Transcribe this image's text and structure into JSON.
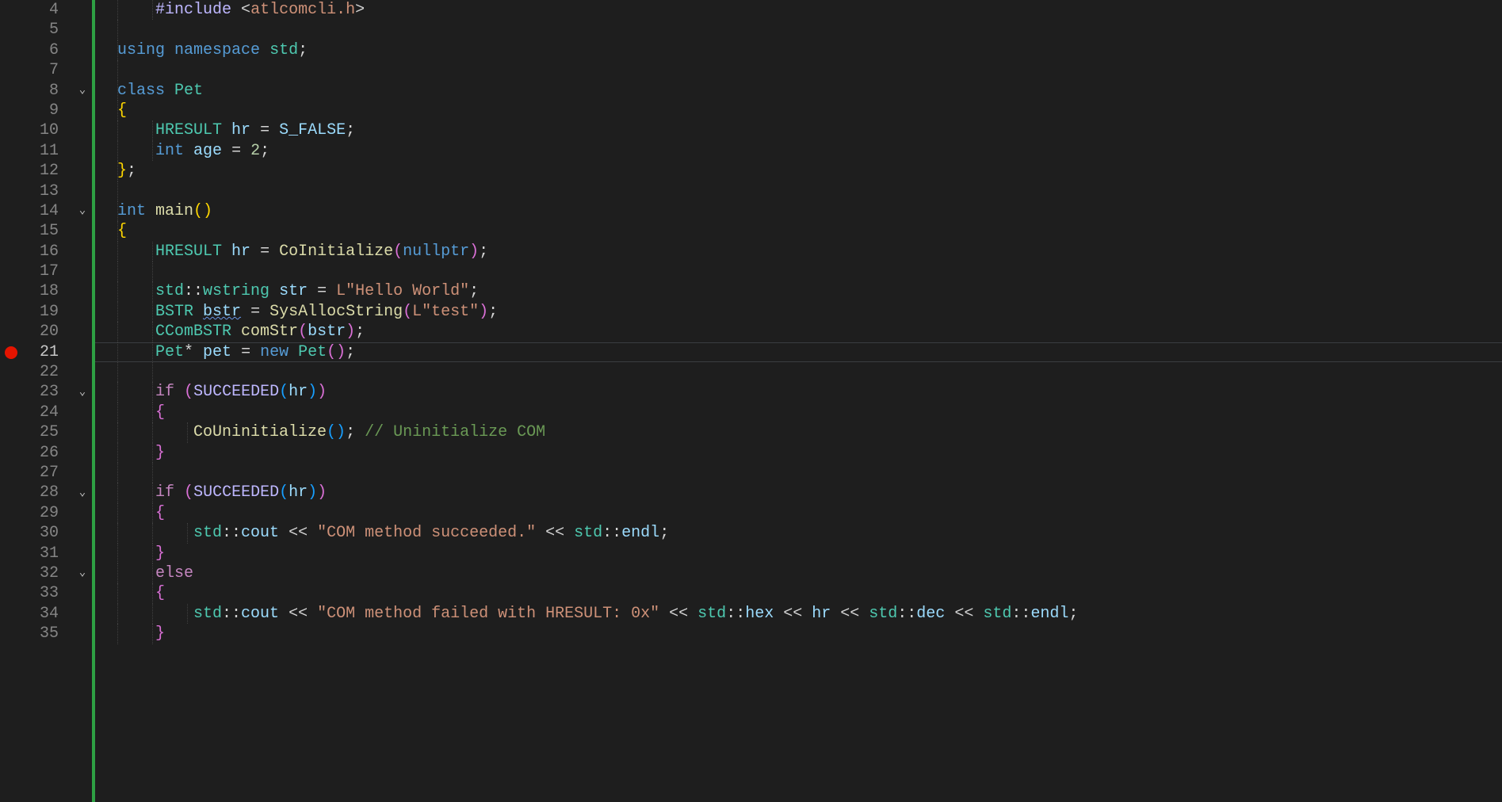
{
  "editor": {
    "first_line_number": 4,
    "last_line_number": 35,
    "current_line": 21,
    "breakpoints": [
      21
    ],
    "fold_markers": {
      "8": "open",
      "14": "open",
      "23": "open",
      "28": "open",
      "32": "open"
    },
    "lines": {
      "4": [
        {
          "cls": "indent",
          "n": 1
        },
        {
          "cls": "tk-macro",
          "t": "#include "
        },
        {
          "cls": "tk-plain",
          "t": "<"
        },
        {
          "cls": "tk-str",
          "t": "atlcomcli.h"
        },
        {
          "cls": "tk-plain",
          "t": ">"
        }
      ],
      "5": [],
      "6": [
        {
          "cls": "tk-kw",
          "t": "using"
        },
        {
          "cls": "tk-plain",
          "t": " "
        },
        {
          "cls": "tk-kw",
          "t": "namespace"
        },
        {
          "cls": "tk-plain",
          "t": " "
        },
        {
          "cls": "tk-type",
          "t": "std"
        },
        {
          "cls": "tk-plain",
          "t": ";"
        }
      ],
      "7": [],
      "8": [
        {
          "cls": "tk-kw",
          "t": "class"
        },
        {
          "cls": "tk-plain",
          "t": " "
        },
        {
          "cls": "tk-type",
          "t": "Pet"
        }
      ],
      "9": [
        {
          "cls": "tk-paren-y",
          "t": "{"
        }
      ],
      "10": [
        {
          "cls": "indent",
          "n": 1
        },
        {
          "cls": "tk-type",
          "t": "HRESULT"
        },
        {
          "cls": "tk-plain",
          "t": " "
        },
        {
          "cls": "tk-var",
          "t": "hr"
        },
        {
          "cls": "tk-plain",
          "t": " = "
        },
        {
          "cls": "tk-var",
          "t": "S_FALSE"
        },
        {
          "cls": "tk-plain",
          "t": ";"
        }
      ],
      "11": [
        {
          "cls": "indent",
          "n": 1
        },
        {
          "cls": "tk-kw",
          "t": "int"
        },
        {
          "cls": "tk-plain",
          "t": " "
        },
        {
          "cls": "tk-var",
          "t": "age"
        },
        {
          "cls": "tk-plain",
          "t": " = "
        },
        {
          "cls": "tk-num",
          "t": "2"
        },
        {
          "cls": "tk-plain",
          "t": ";"
        }
      ],
      "12": [
        {
          "cls": "tk-paren-y",
          "t": "}"
        },
        {
          "cls": "tk-plain",
          "t": ";"
        }
      ],
      "13": [],
      "14": [
        {
          "cls": "tk-kw",
          "t": "int"
        },
        {
          "cls": "tk-plain",
          "t": " "
        },
        {
          "cls": "tk-func",
          "t": "main"
        },
        {
          "cls": "tk-paren-y",
          "t": "()"
        }
      ],
      "15": [
        {
          "cls": "tk-paren-y",
          "t": "{"
        }
      ],
      "16": [
        {
          "cls": "indent",
          "n": 1
        },
        {
          "cls": "tk-type",
          "t": "HRESULT"
        },
        {
          "cls": "tk-plain",
          "t": " "
        },
        {
          "cls": "tk-var",
          "t": "hr"
        },
        {
          "cls": "tk-plain",
          "t": " = "
        },
        {
          "cls": "tk-func",
          "t": "CoInitialize"
        },
        {
          "cls": "tk-paren-p",
          "t": "("
        },
        {
          "cls": "tk-kw",
          "t": "nullptr"
        },
        {
          "cls": "tk-paren-p",
          "t": ")"
        },
        {
          "cls": "tk-plain",
          "t": ";"
        }
      ],
      "17": [
        {
          "cls": "indent",
          "n": 1
        }
      ],
      "18": [
        {
          "cls": "indent",
          "n": 1
        },
        {
          "cls": "tk-type",
          "t": "std"
        },
        {
          "cls": "tk-plain",
          "t": "::"
        },
        {
          "cls": "tk-type",
          "t": "wstring"
        },
        {
          "cls": "tk-plain",
          "t": " "
        },
        {
          "cls": "tk-var",
          "t": "str"
        },
        {
          "cls": "tk-plain",
          "t": " = "
        },
        {
          "cls": "tk-str",
          "t": "L\"Hello World\""
        },
        {
          "cls": "tk-plain",
          "t": ";"
        }
      ],
      "19": [
        {
          "cls": "indent",
          "n": 1
        },
        {
          "cls": "tk-type",
          "t": "BSTR"
        },
        {
          "cls": "tk-plain",
          "t": " "
        },
        {
          "cls": "tk-var squiggle",
          "t": "bstr"
        },
        {
          "cls": "tk-plain",
          "t": " = "
        },
        {
          "cls": "tk-func",
          "t": "SysAllocString"
        },
        {
          "cls": "tk-paren-p",
          "t": "("
        },
        {
          "cls": "tk-str",
          "t": "L\"test\""
        },
        {
          "cls": "tk-paren-p",
          "t": ")"
        },
        {
          "cls": "tk-plain",
          "t": ";"
        }
      ],
      "20": [
        {
          "cls": "indent",
          "n": 1
        },
        {
          "cls": "tk-type",
          "t": "CComBSTR"
        },
        {
          "cls": "tk-plain",
          "t": " "
        },
        {
          "cls": "tk-func",
          "t": "comStr"
        },
        {
          "cls": "tk-paren-p",
          "t": "("
        },
        {
          "cls": "tk-var",
          "t": "bstr"
        },
        {
          "cls": "tk-paren-p",
          "t": ")"
        },
        {
          "cls": "tk-plain",
          "t": ";"
        }
      ],
      "21": [
        {
          "cls": "indent",
          "n": 1
        },
        {
          "cls": "tk-type",
          "t": "Pet"
        },
        {
          "cls": "tk-plain",
          "t": "* "
        },
        {
          "cls": "tk-var",
          "t": "pet"
        },
        {
          "cls": "tk-plain",
          "t": " = "
        },
        {
          "cls": "tk-kw",
          "t": "new"
        },
        {
          "cls": "tk-plain",
          "t": " "
        },
        {
          "cls": "tk-type",
          "t": "Pet"
        },
        {
          "cls": "tk-paren-p",
          "t": "()"
        },
        {
          "cls": "tk-plain",
          "t": ";"
        }
      ],
      "22": [
        {
          "cls": "indent",
          "n": 1
        }
      ],
      "23": [
        {
          "cls": "indent",
          "n": 1
        },
        {
          "cls": "tk-ctrl",
          "t": "if"
        },
        {
          "cls": "tk-plain",
          "t": " "
        },
        {
          "cls": "tk-paren-p",
          "t": "("
        },
        {
          "cls": "tk-macro",
          "t": "SUCCEEDED"
        },
        {
          "cls": "tk-paren-b",
          "t": "("
        },
        {
          "cls": "tk-var",
          "t": "hr"
        },
        {
          "cls": "tk-paren-b",
          "t": ")"
        },
        {
          "cls": "tk-paren-p",
          "t": ")"
        }
      ],
      "24": [
        {
          "cls": "indent",
          "n": 1
        },
        {
          "cls": "tk-paren-p",
          "t": "{"
        }
      ],
      "25": [
        {
          "cls": "indent",
          "n": 2
        },
        {
          "cls": "tk-func",
          "t": "CoUninitialize"
        },
        {
          "cls": "tk-paren-b",
          "t": "()"
        },
        {
          "cls": "tk-plain",
          "t": "; "
        },
        {
          "cls": "tk-com",
          "t": "// Uninitialize COM"
        }
      ],
      "26": [
        {
          "cls": "indent",
          "n": 1
        },
        {
          "cls": "tk-paren-p",
          "t": "}"
        }
      ],
      "27": [
        {
          "cls": "indent",
          "n": 1
        }
      ],
      "28": [
        {
          "cls": "indent",
          "n": 1
        },
        {
          "cls": "tk-ctrl",
          "t": "if"
        },
        {
          "cls": "tk-plain",
          "t": " "
        },
        {
          "cls": "tk-paren-p",
          "t": "("
        },
        {
          "cls": "tk-macro",
          "t": "SUCCEEDED"
        },
        {
          "cls": "tk-paren-b",
          "t": "("
        },
        {
          "cls": "tk-var",
          "t": "hr"
        },
        {
          "cls": "tk-paren-b",
          "t": ")"
        },
        {
          "cls": "tk-paren-p",
          "t": ")"
        }
      ],
      "29": [
        {
          "cls": "indent",
          "n": 1
        },
        {
          "cls": "tk-paren-p",
          "t": "{"
        }
      ],
      "30": [
        {
          "cls": "indent",
          "n": 2
        },
        {
          "cls": "tk-type",
          "t": "std"
        },
        {
          "cls": "tk-plain",
          "t": "::"
        },
        {
          "cls": "tk-var",
          "t": "cout"
        },
        {
          "cls": "tk-plain",
          "t": " << "
        },
        {
          "cls": "tk-str",
          "t": "\"COM method succeeded.\""
        },
        {
          "cls": "tk-plain",
          "t": " << "
        },
        {
          "cls": "tk-type",
          "t": "std"
        },
        {
          "cls": "tk-plain",
          "t": "::"
        },
        {
          "cls": "tk-var",
          "t": "endl"
        },
        {
          "cls": "tk-plain",
          "t": ";"
        }
      ],
      "31": [
        {
          "cls": "indent",
          "n": 1
        },
        {
          "cls": "tk-paren-p",
          "t": "}"
        }
      ],
      "32": [
        {
          "cls": "indent",
          "n": 1
        },
        {
          "cls": "tk-ctrl",
          "t": "else"
        }
      ],
      "33": [
        {
          "cls": "indent",
          "n": 1
        },
        {
          "cls": "tk-paren-p",
          "t": "{"
        }
      ],
      "34": [
        {
          "cls": "indent",
          "n": 2
        },
        {
          "cls": "tk-type",
          "t": "std"
        },
        {
          "cls": "tk-plain",
          "t": "::"
        },
        {
          "cls": "tk-var",
          "t": "cout"
        },
        {
          "cls": "tk-plain",
          "t": " << "
        },
        {
          "cls": "tk-str",
          "t": "\"COM method failed with HRESULT: 0x\""
        },
        {
          "cls": "tk-plain",
          "t": " << "
        },
        {
          "cls": "tk-type",
          "t": "std"
        },
        {
          "cls": "tk-plain",
          "t": "::"
        },
        {
          "cls": "tk-var",
          "t": "hex"
        },
        {
          "cls": "tk-plain",
          "t": " << "
        },
        {
          "cls": "tk-var",
          "t": "hr"
        },
        {
          "cls": "tk-plain",
          "t": " << "
        },
        {
          "cls": "tk-type",
          "t": "std"
        },
        {
          "cls": "tk-plain",
          "t": "::"
        },
        {
          "cls": "tk-var",
          "t": "dec"
        },
        {
          "cls": "tk-plain",
          "t": " << "
        },
        {
          "cls": "tk-type",
          "t": "std"
        },
        {
          "cls": "tk-plain",
          "t": "::"
        },
        {
          "cls": "tk-var",
          "t": "endl"
        },
        {
          "cls": "tk-plain",
          "t": ";"
        }
      ],
      "35": [
        {
          "cls": "indent",
          "n": 1
        },
        {
          "cls": "tk-paren-p",
          "t": "}"
        }
      ]
    },
    "colors": {
      "background": "#1e1e1e",
      "modified_gutter": "#2ea043",
      "breakpoint": "#e51400"
    }
  }
}
